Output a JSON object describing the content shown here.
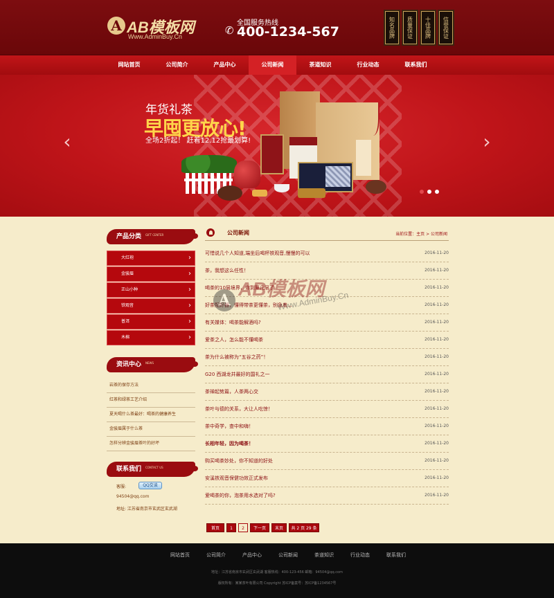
{
  "header": {
    "logo_mark": "A",
    "logo_text": "AB模板网",
    "logo_url": "Www.AdminBuy.Cn",
    "hotline_label": "全国服务热线",
    "hotline_number": "400-1234-567",
    "badges": [
      "知名品牌",
      "质量保证",
      "十佳品牌",
      "信誉保证"
    ]
  },
  "nav": {
    "items": [
      "网站首页",
      "公司简介",
      "产品中心",
      "公司新闻",
      "茶道知识",
      "行业动态",
      "联系我们"
    ],
    "active_index": 3
  },
  "banner": {
    "title1": "年货礼茶",
    "title2": "早囤更放心!",
    "subtitle": "全场2折起！ 赶着12.12抢最划算!",
    "prev_icon": "chevron-left-icon",
    "next_icon": "chevron-right-icon",
    "slide_count": 3,
    "active_slide": 0
  },
  "sidebar": {
    "categories_title": "产品分类",
    "categories_en": "GIFT CENTER",
    "categories": [
      "大红袍",
      "金骏眉",
      "正山小种",
      "铁观音",
      "普洱",
      "木棉"
    ],
    "news_title": "资讯中心",
    "news_en": "NEWS",
    "news": [
      "岩茶的保存方法",
      "红茶和绿茶工艺介绍",
      "夏天喝什么茶最好：喝茶的健康养生",
      "金骏眉属于什么茶",
      "怎样分辨金骏眉茶叶的好坏"
    ],
    "contact_title": "联系我们",
    "contact_en": "CONTACT US",
    "contact_qq_label": "客服:",
    "contact_qq_button": "QQ交谈",
    "contact_email": "94504@qq.com",
    "contact_address": "地址: 江苏省南京市玄武区玄武湖"
  },
  "main": {
    "title": "公司新闻",
    "breadcrumb": "当前位置：主页 > 公司新闻",
    "news": [
      {
        "title": "可惜说几个人知道,端坐后喝杯铁观音,慢慢的可以",
        "date": "2016-11-20",
        "bold": false
      },
      {
        "title": "茶，我想这么任性！",
        "date": "2016-11-20",
        "bold": false
      },
      {
        "title": "喝茶的10层境界，你到第几层了",
        "date": "2016-11-20",
        "bold": false
      },
      {
        "title": "好茶配好器，懂得带茶更懂茶，别急着...",
        "date": "2016-11-20",
        "bold": false
      },
      {
        "title": "有关媒体：喝茶能解酒吗?",
        "date": "2016-11-20",
        "bold": false
      },
      {
        "title": "爱茶之人，怎么能不懂喝茶",
        "date": "2016-11-20",
        "bold": false
      },
      {
        "title": "茶为什么被称为“五谷之药”！",
        "date": "2016-11-20",
        "bold": false
      },
      {
        "title": "G20 西湖龙井最好的国礼之一",
        "date": "2016-11-20",
        "bold": false
      },
      {
        "title": "茶禅起势篇，人茶两心交",
        "date": "2016-11-20",
        "bold": false
      },
      {
        "title": "茶叶与德的关系，大让人吃惊！",
        "date": "2016-11-20",
        "bold": false
      },
      {
        "title": "茶中奇学，查中和嗨！",
        "date": "2016-11-20",
        "bold": false
      },
      {
        "title": "长相年轻，因为喝茶！",
        "date": "2016-11-20",
        "bold": true
      },
      {
        "title": "购买喝茶妙处，你不知道的好处",
        "date": "2016-11-20",
        "bold": false
      },
      {
        "title": "安溪铁观音保健功效正式发布",
        "date": "2016-11-20",
        "bold": false
      },
      {
        "title": "爱喝茶的你，泡茶用水选对了吗?",
        "date": "2016-11-20",
        "bold": false
      }
    ]
  },
  "watermark": {
    "mark": "A",
    "text": "AB模板网",
    "url": "Www.AdminBuy.Cn"
  },
  "pagination": {
    "items": [
      "首页",
      "1",
      "2",
      "下一页",
      "末页",
      "共 2 页 29 条"
    ],
    "current_index": 2
  },
  "footer": {
    "nav": [
      "网站首页",
      "公司简介",
      "产品中心",
      "公司新闻",
      "茶道知识",
      "行业动态",
      "联系我们"
    ],
    "line1": "地址：江苏省南京市玄武区玄武湖    客服热线：400-123-456    邮箱：94504@qq.com",
    "line2": "版权所有：某某茶叶有限公司  Copyright    苏ICP备案号：苏ICP备1234567号"
  },
  "colors": {
    "header_bg": "#7d0d10",
    "nav_bg": "#c21518",
    "accent": "#a9070d",
    "page_bg": "#f6eccb",
    "footer_bg": "#0d0d0d"
  }
}
